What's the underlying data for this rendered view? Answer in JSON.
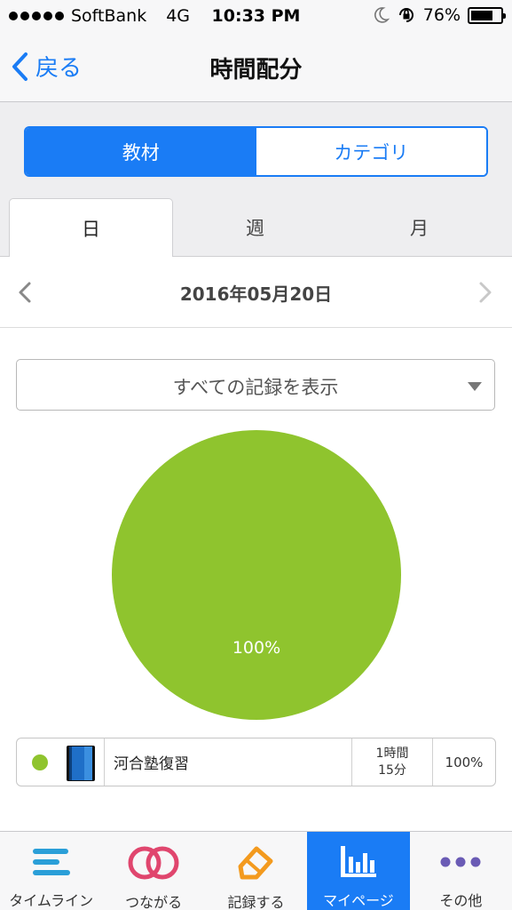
{
  "status_bar": {
    "carrier": "SoftBank",
    "network": "4G",
    "time": "10:33 PM",
    "battery": "76%",
    "battery_level": 0.76
  },
  "nav": {
    "back_label": "戻る",
    "title": "時間配分"
  },
  "segments": [
    {
      "label": "教材",
      "active": true
    },
    {
      "label": "カテゴリ",
      "active": false
    }
  ],
  "period_tabs": [
    {
      "label": "日",
      "active": true
    },
    {
      "label": "週",
      "active": false
    },
    {
      "label": "月",
      "active": false
    }
  ],
  "date": {
    "label": "2016年05月20日"
  },
  "filter": {
    "label": "すべての記録を表示"
  },
  "chart_data": {
    "type": "pie",
    "slices": [
      {
        "label": "河合塾復習",
        "value": 100,
        "color": "#8fc42e",
        "display": "100%"
      }
    ]
  },
  "legend": [
    {
      "name": "河合塾復習",
      "time_line1": "1時間",
      "time_line2": "15分",
      "percent": "100%",
      "color": "#8fc42e"
    }
  ],
  "tab_bar": {
    "tabs": [
      {
        "label": "タイムライン",
        "icon": "timeline-icon",
        "color": "#2a9fd8"
      },
      {
        "label": "つながる",
        "icon": "connect-rings-icon",
        "color": "#e0466e"
      },
      {
        "label": "記録する",
        "icon": "pencil-record-icon",
        "color": "#f39a1e"
      },
      {
        "label": "マイページ",
        "icon": "bar-chart-icon",
        "color": "#ffffff",
        "active": true
      },
      {
        "label": "その他",
        "icon": "more-dots-icon",
        "color": "#6a5bb5"
      }
    ]
  },
  "colors": {
    "accent": "#1a7cf5",
    "pie": "#8fc42e"
  }
}
